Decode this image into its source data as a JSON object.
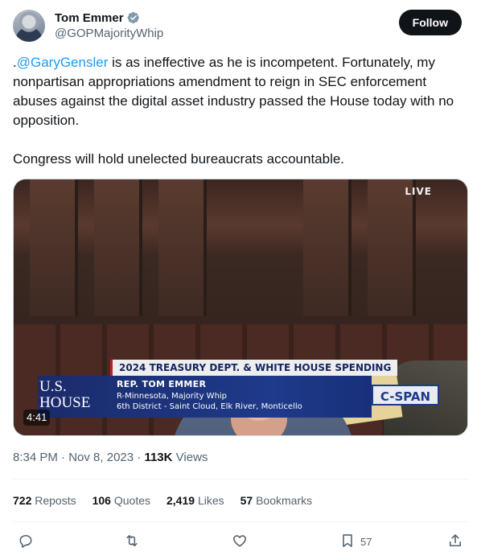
{
  "author": {
    "name": "Tom Emmer",
    "handle": "@GOPMajorityWhip",
    "verified_color": "#829aab"
  },
  "follow_button": {
    "label": "Follow"
  },
  "tweet": {
    "line1_prefix": ".",
    "mention": "@GaryGensler",
    "paragraph1_rest": " is as ineffective as he is incompetent. Fortunately, my nonpartisan appropriations amendment to reign in SEC enforcement abuses against the digital asset industry passed the House today with no opposition.",
    "paragraph2": "Congress will hold unelected bureaucrats accountable."
  },
  "media": {
    "live_badge": "LIVE",
    "lower_third_title": "2024 TREASURY DEPT. & WHITE HOUSE SPENDING",
    "house_line1": "U.S.",
    "house_line2": "HOUSE",
    "speaker_name": "REP. TOM EMMER",
    "speaker_sub1": "R-Minnesota, Majority Whip",
    "speaker_sub2": "6th District - Saint Cloud, Elk River, Monticello",
    "network": "C-SPAN",
    "duration": "4:41"
  },
  "meta": {
    "time": "8:34 PM",
    "date": "Nov 8, 2023",
    "views_count": "113K",
    "views_label": "Views"
  },
  "stats": [
    {
      "num": "722",
      "label": "Reposts"
    },
    {
      "num": "106",
      "label": "Quotes"
    },
    {
      "num": "2,419",
      "label": "Likes"
    },
    {
      "num": "57",
      "label": "Bookmarks"
    }
  ],
  "actions": {
    "bookmark_count": "57"
  },
  "colors": {
    "accent": "#1d9bf0",
    "text_primary": "#0f1419",
    "text_secondary": "#536471"
  }
}
